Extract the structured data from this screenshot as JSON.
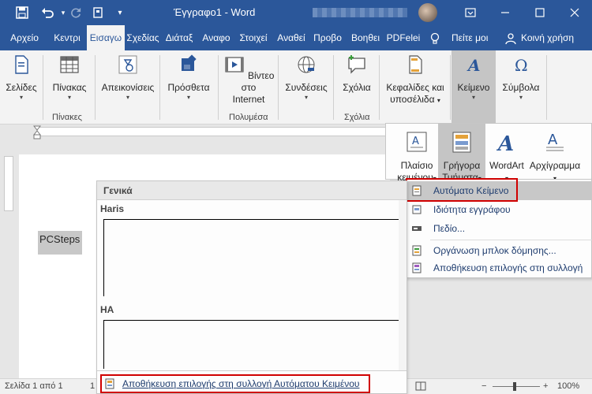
{
  "titlebar": {
    "title": "Έγγραφο1 - Word",
    "quick_access": [
      "save-icon",
      "undo-icon",
      "redo-icon",
      "touch-mode-icon",
      "customize-icon"
    ],
    "window_buttons": [
      "ribbon-display-icon",
      "minimize-icon",
      "maximize-icon",
      "close-icon"
    ]
  },
  "tabs": [
    {
      "label": "Αρχείο"
    },
    {
      "label": "Κεντρι"
    },
    {
      "label": "Εισαγω"
    },
    {
      "label": "Σχεδίας"
    },
    {
      "label": "Διάταξ"
    },
    {
      "label": "Αναφο"
    },
    {
      "label": "Στοιχεί"
    },
    {
      "label": "Αναθεί"
    },
    {
      "label": "Προβο"
    },
    {
      "label": "Βοηθει"
    },
    {
      "label": "PDFelei"
    }
  ],
  "tabs_right": {
    "tell_me": "Πείτε μοι",
    "share": "Κοινή χρήση"
  },
  "ribbon": {
    "pages": "Σελίδες",
    "table": "Πίνακας",
    "tables_group": "Πίνακες",
    "illustrations": "Απεικονίσεις",
    "addins": "Πρόσθετα",
    "video": [
      "Βίντεο στο",
      "Internet"
    ],
    "media_group": "Πολυμέσα",
    "links": "Συνδέσεις",
    "comments": "Σχόλια",
    "comments_group": "Σχόλια",
    "header_footer": [
      "Κεφαλίδες και",
      "υποσέλιδα"
    ],
    "text": "Κείμενο",
    "symbols": "Σύμβολα"
  },
  "text_gallery": {
    "textbox": [
      "Πλαίσιο",
      "κειμένου"
    ],
    "quickparts": [
      "Γρήγορα",
      "Τμήματα"
    ],
    "wordart": "WordArt",
    "dropcap": "Αρχίγραμμα"
  },
  "quickparts_menu": {
    "items": [
      {
        "label": "Αυτόματο Κείμενο"
      },
      {
        "label": "Ιδιότητα εγγράφου"
      },
      {
        "label": "Πεδίο..."
      },
      {
        "label": "Οργάνωση μπλοκ δόμησης..."
      },
      {
        "label": "Αποθήκευση επιλογής στη συλλογή"
      }
    ]
  },
  "autotext": {
    "header": "Γενικά",
    "entries": [
      "Haris",
      "HA"
    ],
    "save_label": "Αποθήκευση επιλογής στη συλλογή Αυτόματου Κειμένου"
  },
  "document": {
    "selected_text": "PCSteps"
  },
  "statusbar": {
    "page": "Σελίδα 1 από 1",
    "page_fragment": "1",
    "zoom": "100%",
    "minus": "−",
    "plus": "+"
  },
  "colors": {
    "word_blue": "#2b579a",
    "highlight": "#d00000"
  }
}
